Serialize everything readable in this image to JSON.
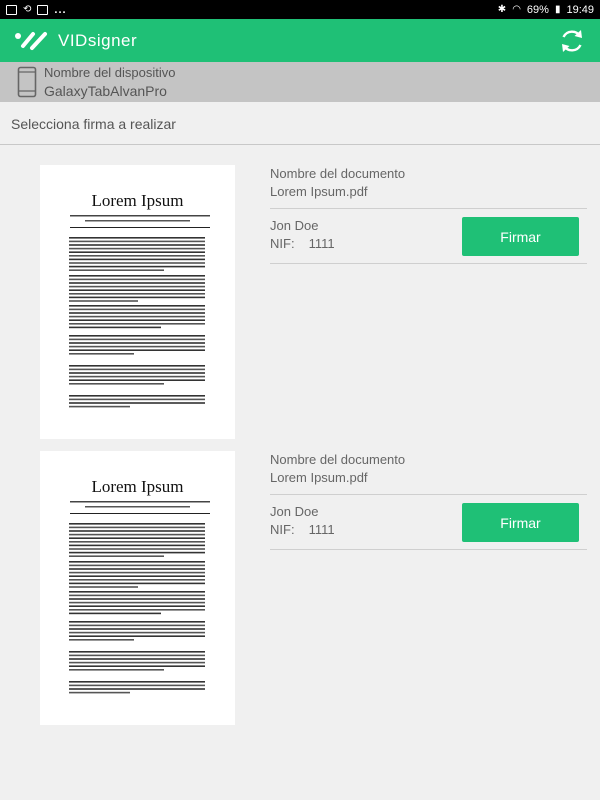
{
  "status_bar": {
    "dots": "...",
    "battery": "69%",
    "time": "19:49"
  },
  "app_bar": {
    "title": "VIDsigner",
    "logo_icon": "vidsigner-logo-icon",
    "refresh_icon": "refresh-icon"
  },
  "device": {
    "label": "Nombre del dispositivo",
    "name": "GalaxyTabAlvanPro"
  },
  "section_title": "Selecciona firma a realizar",
  "colors": {
    "accent": "#1fc076",
    "device_bar": "#c4c4c4",
    "background": "#f0f0f0"
  },
  "documents": [
    {
      "thumbnail_title": "Lorem Ipsum",
      "doc_label": "Nombre del documento",
      "doc_name": "Lorem Ipsum.pdf",
      "signer_name": "Jon Doe",
      "nif_label": "NIF:",
      "nif_value": "1111",
      "sign_label": "Firmar"
    },
    {
      "thumbnail_title": "Lorem Ipsum",
      "doc_label": "Nombre del documento",
      "doc_name": "Lorem Ipsum.pdf",
      "signer_name": "Jon Doe",
      "nif_label": "NIF:",
      "nif_value": "1111",
      "sign_label": "Firmar"
    }
  ]
}
